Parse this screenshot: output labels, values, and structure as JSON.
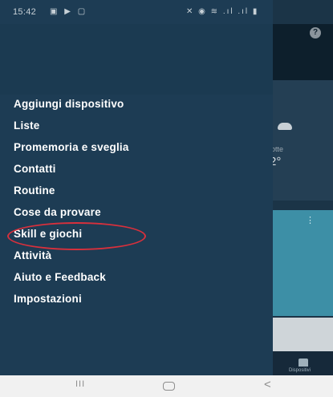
{
  "status_bar": {
    "time": "15:42",
    "left_icons": "▣ ▶ ▢",
    "right_icons": "✕ ◉ ≋ .ıl .ıl ▮"
  },
  "background_app": {
    "help_icon": "?",
    "weather_label": "otte",
    "weather_temp": "2°",
    "card_menu_icon": "⋮",
    "nav_label": "Dispositivi"
  },
  "drawer": {
    "items": [
      {
        "label": "Aggiungi dispositivo"
      },
      {
        "label": "Liste"
      },
      {
        "label": "Promemoria e sveglia"
      },
      {
        "label": "Contatti"
      },
      {
        "label": "Routine"
      },
      {
        "label": "Cose da provare"
      },
      {
        "label": "Skill e giochi"
      },
      {
        "label": "Attività"
      },
      {
        "label": "Aiuto e Feedback"
      },
      {
        "label": "Impostazioni"
      }
    ],
    "highlighted_item": "Skill e giochi",
    "highlight_color": "#d8303c"
  },
  "android_nav": {
    "recents": "III",
    "back": "<"
  },
  "colors": {
    "drawer_bg": "#1d3c54",
    "menu_text": "#ffffff"
  }
}
